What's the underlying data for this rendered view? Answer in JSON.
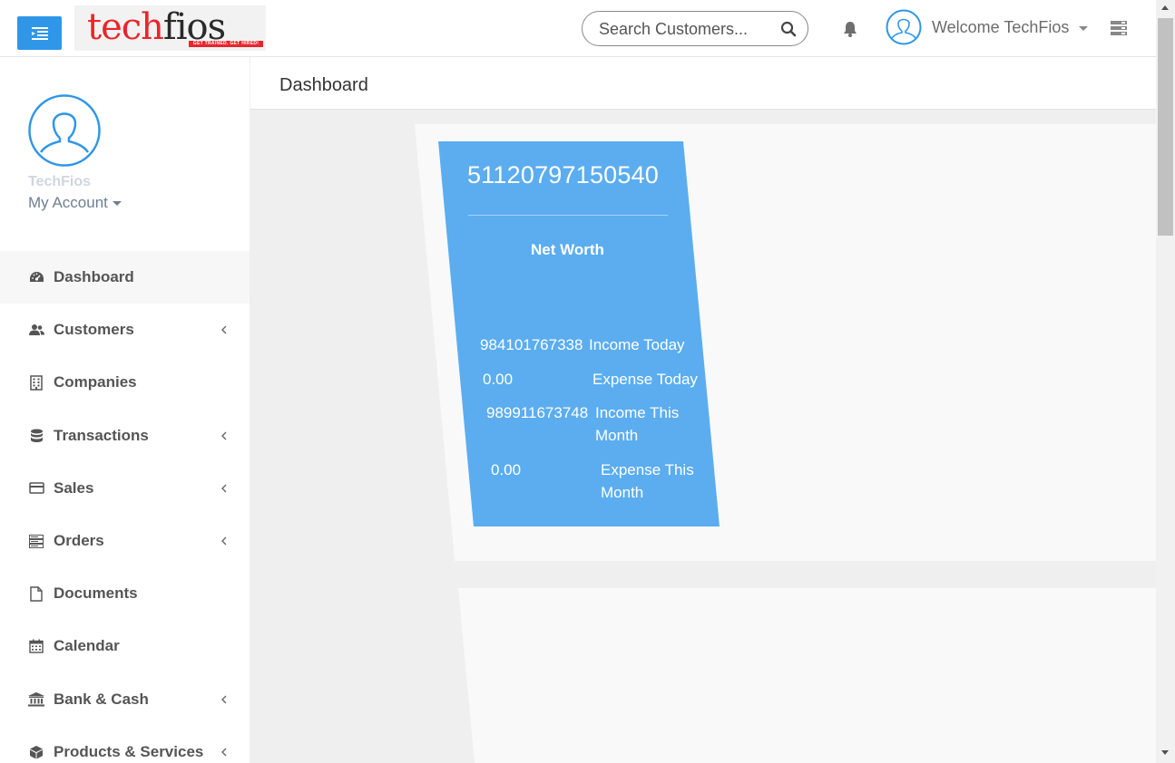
{
  "header": {
    "logo": {
      "brand_part1": "tech",
      "brand_part2": "fios",
      "tagline": "GET TRAINED. GET HIRED!"
    },
    "search": {
      "placeholder": "Search Customers..."
    },
    "welcome_text": "Welcome TechFios"
  },
  "sidebar": {
    "profile": {
      "name": "TechFios",
      "account_label": "My Account"
    },
    "items": [
      {
        "label": "Dashboard",
        "icon": "dashboard-icon",
        "has_submenu": false,
        "active": true
      },
      {
        "label": "Customers",
        "icon": "users-icon",
        "has_submenu": true
      },
      {
        "label": "Companies",
        "icon": "building-icon",
        "has_submenu": false
      },
      {
        "label": "Transactions",
        "icon": "database-icon",
        "has_submenu": true
      },
      {
        "label": "Sales",
        "icon": "credit-card-icon",
        "has_submenu": true
      },
      {
        "label": "Orders",
        "icon": "server-icon",
        "has_submenu": true
      },
      {
        "label": "Documents",
        "icon": "file-icon",
        "has_submenu": false
      },
      {
        "label": "Calendar",
        "icon": "calendar-icon",
        "has_submenu": false
      },
      {
        "label": "Bank & Cash",
        "icon": "bank-icon",
        "has_submenu": true
      },
      {
        "label": "Products & Services",
        "icon": "cube-icon",
        "has_submenu": true
      }
    ]
  },
  "main": {
    "page_title": "Dashboard",
    "summary_card": {
      "net_worth_value": "51120797150540",
      "net_worth_label": "Net Worth",
      "rows": [
        {
          "value": "984101767338",
          "label": "Income Today"
        },
        {
          "value": "0.00",
          "label": "Expense Today"
        },
        {
          "value": "989911673748",
          "label": "Income This Month"
        },
        {
          "value": "0.00",
          "label": "Expense This Month"
        }
      ]
    }
  },
  "colors": {
    "primary": "#2f96e8",
    "card_blue": "#5badf0",
    "logo_red": "#e8262c"
  }
}
